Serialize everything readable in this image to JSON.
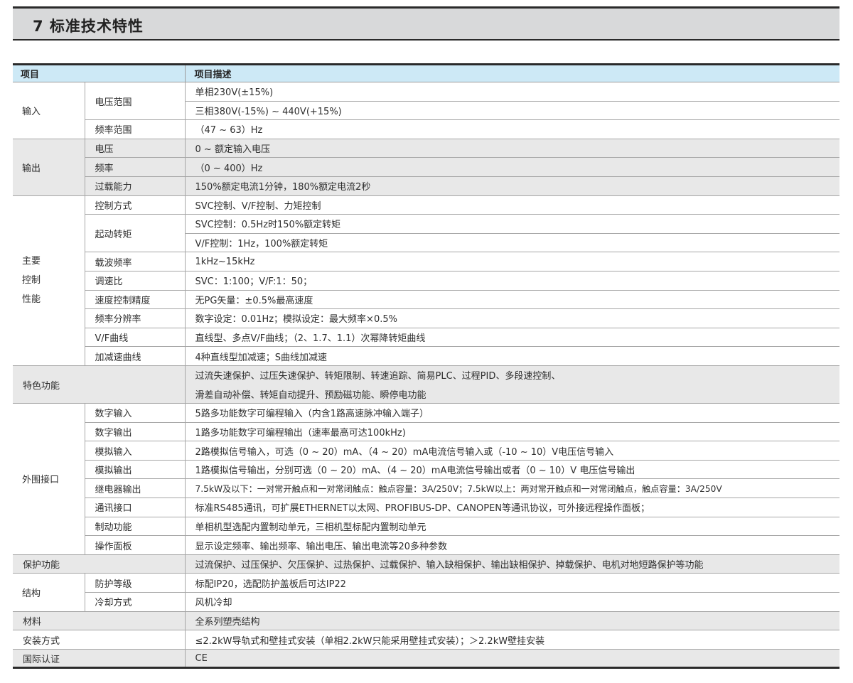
{
  "title": "7 标准技术特性",
  "header": {
    "col_item": "项目",
    "col_desc": "项目描述"
  },
  "groups": {
    "input": {
      "label": "输入",
      "voltage_range": "电压范围",
      "voltage_1": "单相230V(±15%)",
      "voltage_2": "三相380V(-15%) ~ 440V(+15%)",
      "freq_range": "频率范围",
      "freq_desc": "（47 ~ 63）Hz"
    },
    "output": {
      "label": "输出",
      "voltage": "电压",
      "voltage_desc": "0 ~ 额定输入电压",
      "freq": "频率",
      "freq_desc": "（0 ~ 400）Hz",
      "overload": "过载能力",
      "overload_desc": "150%额定电流1分钟，180%额定电流2秒"
    },
    "control": {
      "label_1": "主要",
      "label_2": "控制",
      "label_3": "性能",
      "mode": "控制方式",
      "mode_desc": "SVC控制、V/F控制、力矩控制",
      "start_torque": "起动转矩",
      "start_torque_1": "SVC控制：0.5Hz时150%额定转矩",
      "start_torque_2": "V/F控制：1Hz，100%额定转矩",
      "carrier": "载波频率",
      "carrier_desc": "1kHz~15kHz",
      "speed_ratio": "调速比",
      "speed_ratio_desc": "SVC：1:100；V/F:1：50；",
      "speed_accuracy": "速度控制精度",
      "speed_accuracy_desc": "无PG矢量：±0.5%最高速度",
      "freq_resolution": "频率分辨率",
      "freq_resolution_desc": "数字设定：0.01Hz；模拟设定：最大频率×0.5%",
      "vf_curve": "V/F曲线",
      "vf_curve_desc": "直线型、多点V/F曲线；（2、1.7、1.1）次幂降转矩曲线",
      "accel_curve": "加减速曲线",
      "accel_curve_desc": "4种直线型加减速；S曲线加减速"
    },
    "features": {
      "label": "特色功能",
      "desc_1": "过流失速保护、过压失速保护、转矩限制、转速追踪、简易PLC、过程PID、多段速控制、",
      "desc_2": "滑差自动补偿、转矩自动提升、预励磁功能、瞬停电功能"
    },
    "interface": {
      "label": "外围接口",
      "di": "数字输入",
      "di_desc": "5路多功能数字可编程输入（内含1路高速脉冲输入端子）",
      "do": "数字输出",
      "do_desc": "1路多功能数字可编程输出（速率最高可达100kHz)",
      "ai": "模拟输入",
      "ai_desc": "2路模拟信号输入，可选（0 ~ 20）mA、（4 ~ 20）mA电流信号输入或（-10 ~ 10）V电压信号输入",
      "ao": "模拟输出",
      "ao_desc": "1路模拟信号输出，分别可选（0 ~ 20）mA、（4 ~ 20）mA电流信号输出或者（0 ~ 10）V 电压信号输出",
      "relay": "继电器输出",
      "relay_desc": "7.5kW及以下：一对常开触点和一对常闭触点：触点容量：3A/250V；7.5kW以上：两对常开触点和一对常闭触点，触点容量：3A/250V",
      "comm": "通讯接口",
      "comm_desc": "标准RS485通讯，可扩展ETHERNET以太网、PROFIBUS-DP、CANOPEN等通讯协议，可外接远程操作面板；",
      "brake": "制动功能",
      "brake_desc": "单相机型选配内置制动单元，三相机型标配内置制动单元",
      "panel": "操作面板",
      "panel_desc": "显示设定频率、输出频率、输出电压、输出电流等20多种参数"
    },
    "protection": {
      "label": "保护功能",
      "desc": "过流保护、过压保护、欠压保护、过热保护、过载保护、输入缺相保护、输出缺相保护、掉载保护、电机对地短路保护等功能"
    },
    "structure": {
      "label": "结构",
      "ip": "防护等级",
      "ip_desc": "标配IP20，选配防护盖板后可达IP22",
      "cooling": "冷却方式",
      "cooling_desc": "风机冷却"
    },
    "material": {
      "label": "材料",
      "desc": "全系列塑壳结构"
    },
    "install": {
      "label": "安装方式",
      "desc": "≤2.2kW导轨式和壁挂式安装（单相2.2kW只能采用壁挂式安装）；＞2.2kW壁挂安装"
    },
    "cert": {
      "label": "国际认证",
      "desc": "CE"
    }
  }
}
